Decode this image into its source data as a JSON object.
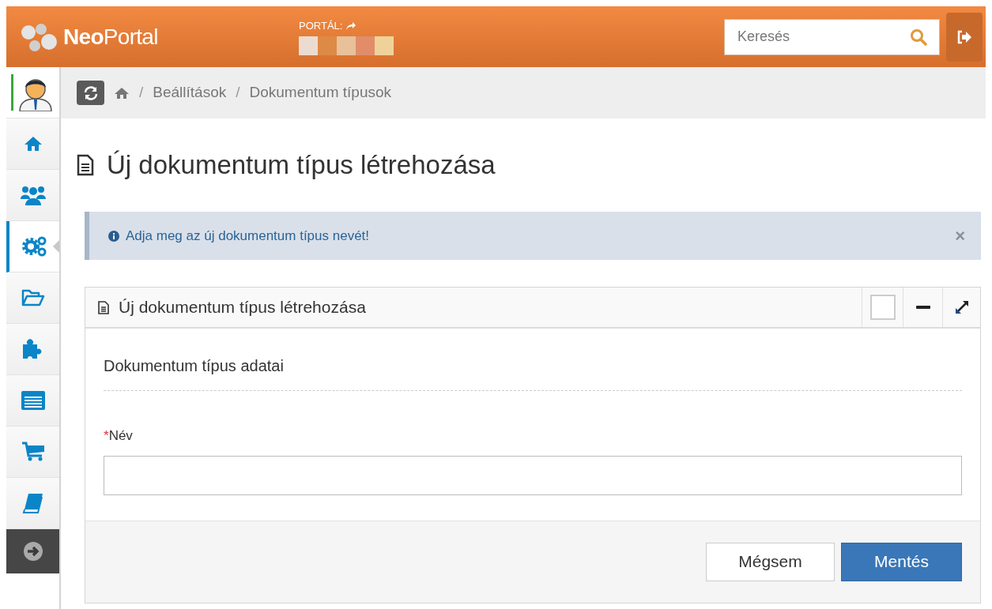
{
  "header": {
    "logo_bold": "Neo",
    "logo_light": "Portal",
    "portal_label": "PORTÁL:",
    "search": {
      "placeholder": "Keresés"
    }
  },
  "sidebar": {
    "items": [
      {
        "selected": false
      },
      {
        "selected": false
      },
      {
        "selected": true
      },
      {
        "selected": false
      },
      {
        "selected": false
      },
      {
        "selected": false
      },
      {
        "selected": false
      },
      {
        "selected": false
      }
    ]
  },
  "breadcrumb": [
    {
      "separator": "/",
      "label": "Beállítások"
    },
    {
      "separator": "/",
      "label": "Dokumentum típusok"
    }
  ],
  "page_title": "Új dokumentum típus létrehozása",
  "alert": {
    "text": "Adja meg az új dokumentum típus nevét!",
    "close": "×"
  },
  "panel": {
    "title": "Új dokumentum típus létrehozása",
    "section_title": "Dokumentum típus adatai",
    "fields": [
      {
        "label": "Név",
        "required_mark": "*"
      }
    ],
    "buttons": [
      {
        "label": "Mégsem",
        "kind": "default"
      },
      {
        "label": "Mentés",
        "kind": "primary"
      }
    ]
  }
}
